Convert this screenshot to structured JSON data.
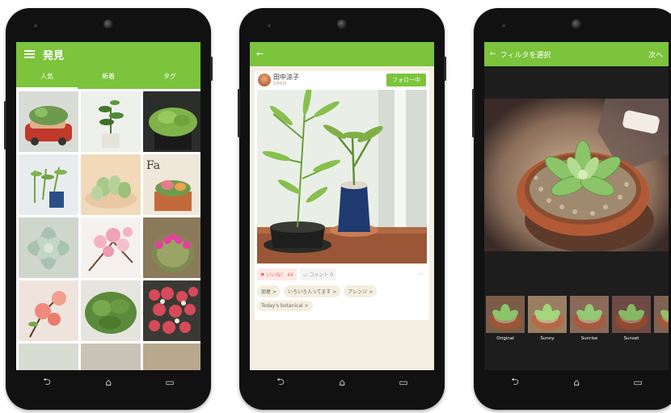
{
  "screen1": {
    "title": "発見",
    "tabs": [
      "人気",
      "新着",
      "タグ"
    ],
    "active_tab": "人気"
  },
  "screen2": {
    "back": "←",
    "user_name": "田中涼子",
    "date": "5月6日",
    "follow_label": "フォロー中",
    "like_label": "♥ いいね！ 44",
    "comment_label": "▭ コメント  0",
    "more_label": "···",
    "tags": [
      "部屋 >",
      "いろいろ入ってます >",
      "アレンジ >",
      "Today's botanical >"
    ]
  },
  "screen3": {
    "back": "←",
    "title": "フィルタを選択",
    "next_label": "次へ",
    "filters": [
      "Original",
      "Sunny",
      "Sunrise",
      "Sunset",
      "H"
    ]
  },
  "navbar": {
    "back": "⮌",
    "home": "⌂",
    "recent": "▭"
  },
  "colors": {
    "accent": "#7bc43b",
    "cream": "#f3eee2",
    "dark": "#1d1d1d"
  }
}
